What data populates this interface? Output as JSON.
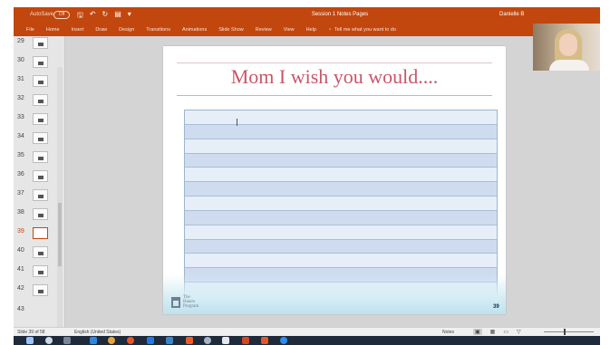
{
  "titlebar": {
    "autosave_label": "AutoSave",
    "autosave_state": "Off",
    "document_title": "Session 1 Notes Pages",
    "user_name": "Danielle B"
  },
  "ribbon": {
    "tabs": [
      "File",
      "Home",
      "Insert",
      "Draw",
      "Design",
      "Transitions",
      "Animations",
      "Slide Show",
      "Review",
      "View",
      "Help"
    ],
    "tell_me": "Tell me what you want to do"
  },
  "thumbnails": [
    {
      "number": "29"
    },
    {
      "number": "30"
    },
    {
      "number": "31"
    },
    {
      "number": "32"
    },
    {
      "number": "33"
    },
    {
      "number": "34"
    },
    {
      "number": "35"
    },
    {
      "number": "36"
    },
    {
      "number": "37"
    },
    {
      "number": "38"
    },
    {
      "number": "39",
      "active": true
    },
    {
      "number": "40"
    },
    {
      "number": "41"
    },
    {
      "number": "42"
    },
    {
      "number": "43"
    }
  ],
  "slide": {
    "heading": "Mom I wish you would....",
    "logo_lines": [
      "The",
      "Hauen",
      "Program"
    ],
    "page_number": "39",
    "line_count": 13
  },
  "statusbar": {
    "slide_count": "Slide 39 of 58",
    "language": "English (United States)",
    "notes_label": "Notes"
  },
  "colors": {
    "ribbon": "#c2470e",
    "heading": "#c8566a",
    "band_light": "#e6eef8",
    "band_dark": "#cfdcef",
    "taskbar": "#1f2a3a"
  }
}
